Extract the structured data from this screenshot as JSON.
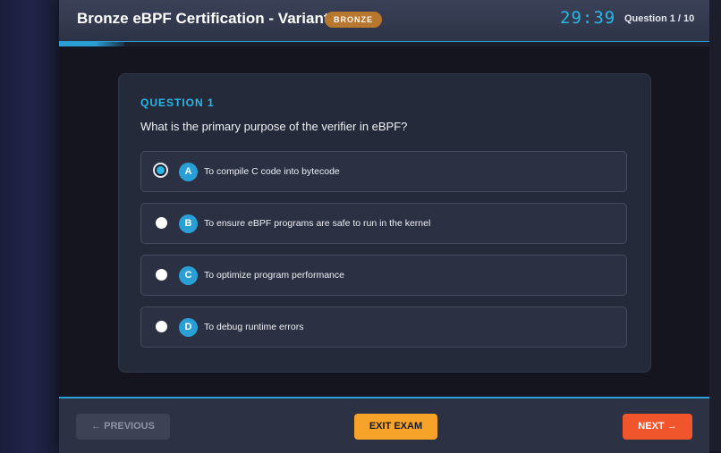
{
  "header": {
    "title": "Bronze eBPF Certification - Variant 2",
    "badge": "BRONZE",
    "timer": "29:39",
    "question_counter": "Question 1 / 10"
  },
  "progress": {
    "fraction": 0.1
  },
  "question": {
    "label": "QUESTION 1",
    "text": "What is the primary purpose of the verifier in eBPF?",
    "selected": "A",
    "options": [
      {
        "letter": "A",
        "text": "To compile C code into bytecode"
      },
      {
        "letter": "B",
        "text": "To ensure eBPF programs are safe to run in the kernel"
      },
      {
        "letter": "C",
        "text": "To optimize program performance"
      },
      {
        "letter": "D",
        "text": "To debug runtime errors"
      }
    ]
  },
  "footer": {
    "previous_label": "← PREVIOUS",
    "exit_label": "EXIT EXAM",
    "next_label": "NEXT →"
  },
  "colors": {
    "accent": "#2a9fd6",
    "badge": "#b8772e",
    "exit": "#f7a228",
    "next": "#f1552b"
  }
}
